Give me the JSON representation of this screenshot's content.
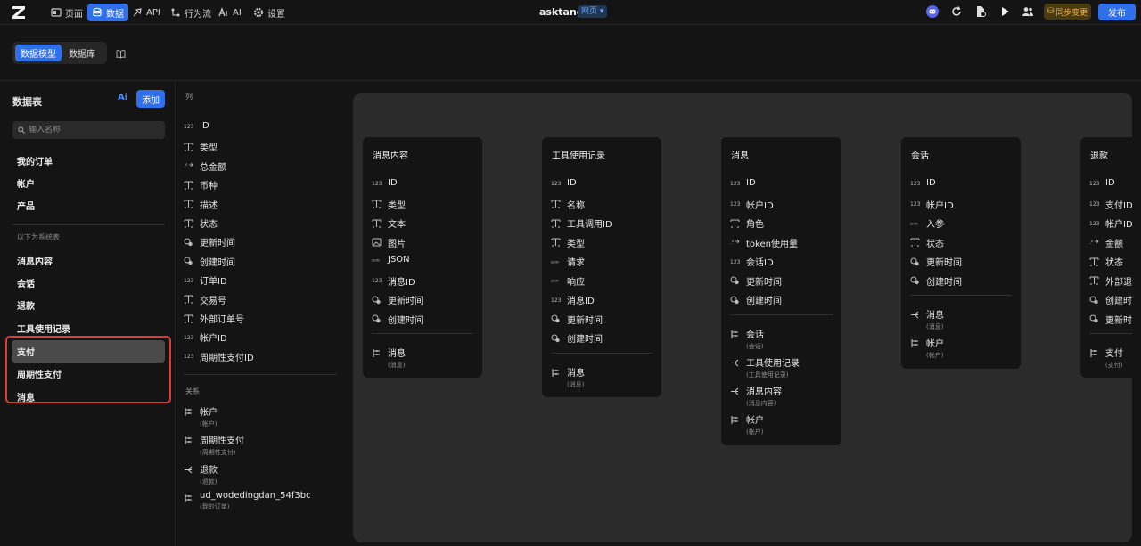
{
  "topbar": {
    "nav": [
      {
        "label": "页面",
        "icon": "pages-icon"
      },
      {
        "label": "数据",
        "icon": "database-icon"
      },
      {
        "label": "API",
        "icon": "api-icon"
      },
      {
        "label": "行为流",
        "icon": "flow-icon"
      },
      {
        "label": "AI",
        "icon": "ai-icon"
      },
      {
        "label": "设置",
        "icon": "gear-icon"
      }
    ],
    "app_title": "asktang",
    "page_badge": "网页",
    "sync_label": "同步变更",
    "publish_label": "发布",
    "accent": "#2f6fea"
  },
  "subbar": {
    "tabs": [
      "数据模型",
      "数据库"
    ]
  },
  "sidebar": {
    "title": "数据表",
    "ai_label": "Ai",
    "add_label": "添加",
    "search_placeholder": "输入名称",
    "user_tables": [
      "我的订单",
      "帐户",
      "产品"
    ],
    "system_section": "以下为系统表",
    "system_tables": [
      "消息内容",
      "会话",
      "退款",
      "工具使用记录",
      "支付",
      "周期性支付",
      "消息"
    ],
    "selected": "支付"
  },
  "columns_panel": {
    "columns_header": "列",
    "columns": [
      {
        "name": "ID",
        "icon": "number-icon"
      },
      {
        "name": "类型",
        "icon": "text-icon"
      },
      {
        "name": "总金额",
        "icon": "decimal-icon"
      },
      {
        "name": "币种",
        "icon": "text-icon"
      },
      {
        "name": "描述",
        "icon": "text-icon"
      },
      {
        "name": "状态",
        "icon": "text-icon"
      },
      {
        "name": "更新时间",
        "icon": "clock-icon"
      },
      {
        "name": "创建时间",
        "icon": "clock-icon"
      },
      {
        "name": "订单ID",
        "icon": "number-icon"
      },
      {
        "name": "交易号",
        "icon": "text-icon"
      },
      {
        "name": "外部订单号",
        "icon": "text-icon"
      },
      {
        "name": "帐户ID",
        "icon": "number-icon"
      },
      {
        "name": "周期性支付ID",
        "icon": "number-icon"
      }
    ],
    "relations_header": "关系",
    "relations": [
      {
        "name": "帐户",
        "sub": "(帐户)",
        "icon": "relation-one-icon"
      },
      {
        "name": "周期性支付",
        "sub": "(周期性支付)",
        "icon": "relation-one-icon"
      },
      {
        "name": "退款",
        "sub": "(退款)",
        "icon": "relation-many-icon"
      },
      {
        "name": "ud_wodedingdan_54f3bc",
        "sub": "(我的订单)",
        "icon": "relation-one-icon"
      }
    ]
  },
  "canvas": {
    "cards": [
      {
        "title": "消息内容",
        "fields": [
          {
            "name": "ID",
            "icon": "number-icon"
          },
          {
            "name": "类型",
            "icon": "text-icon"
          },
          {
            "name": "文本",
            "icon": "text-icon"
          },
          {
            "name": "图片",
            "icon": "image-icon"
          },
          {
            "name": "JSON",
            "icon": "json-icon"
          },
          {
            "name": "消息ID",
            "icon": "number-icon"
          },
          {
            "name": "更新时间",
            "icon": "clock-icon"
          },
          {
            "name": "创建时间",
            "icon": "clock-icon"
          }
        ],
        "relations": [
          {
            "name": "消息",
            "sub": "(消息)",
            "icon": "relation-one-icon"
          }
        ]
      },
      {
        "title": "工具使用记录",
        "fields": [
          {
            "name": "ID",
            "icon": "number-icon"
          },
          {
            "name": "名称",
            "icon": "text-icon"
          },
          {
            "name": "工具调用ID",
            "icon": "text-icon"
          },
          {
            "name": "类型",
            "icon": "text-icon"
          },
          {
            "name": "请求",
            "icon": "json-icon"
          },
          {
            "name": "响应",
            "icon": "json-icon"
          },
          {
            "name": "消息ID",
            "icon": "number-icon"
          },
          {
            "name": "更新时间",
            "icon": "clock-icon"
          },
          {
            "name": "创建时间",
            "icon": "clock-icon"
          }
        ],
        "relations": [
          {
            "name": "消息",
            "sub": "(消息)",
            "icon": "relation-one-icon"
          }
        ]
      },
      {
        "title": "消息",
        "fields": [
          {
            "name": "ID",
            "icon": "number-icon"
          },
          {
            "name": "帐户ID",
            "icon": "number-icon"
          },
          {
            "name": "角色",
            "icon": "text-icon"
          },
          {
            "name": "token使用量",
            "icon": "decimal-icon"
          },
          {
            "name": "会话ID",
            "icon": "number-icon"
          },
          {
            "name": "更新时间",
            "icon": "clock-icon"
          },
          {
            "name": "创建时间",
            "icon": "clock-icon"
          }
        ],
        "relations": [
          {
            "name": "会话",
            "sub": "(会话)",
            "icon": "relation-one-icon"
          },
          {
            "name": "工具使用记录",
            "sub": "(工具使用记录)",
            "icon": "relation-many-icon"
          },
          {
            "name": "消息内容",
            "sub": "(消息内容)",
            "icon": "relation-many-icon"
          },
          {
            "name": "帐户",
            "sub": "(帐户)",
            "icon": "relation-one-icon"
          }
        ]
      },
      {
        "title": "会话",
        "fields": [
          {
            "name": "ID",
            "icon": "number-icon"
          },
          {
            "name": "帐户ID",
            "icon": "number-icon"
          },
          {
            "name": "入参",
            "icon": "json-icon"
          },
          {
            "name": "状态",
            "icon": "text-icon"
          },
          {
            "name": "更新时间",
            "icon": "clock-icon"
          },
          {
            "name": "创建时间",
            "icon": "clock-icon"
          }
        ],
        "relations": [
          {
            "name": "消息",
            "sub": "(消息)",
            "icon": "relation-many-icon"
          },
          {
            "name": "帐户",
            "sub": "(帐户)",
            "icon": "relation-one-icon"
          }
        ]
      },
      {
        "title": "退款",
        "fields": [
          {
            "name": "ID",
            "icon": "number-icon"
          },
          {
            "name": "支付ID",
            "icon": "number-icon"
          },
          {
            "name": "帐户ID",
            "icon": "number-icon"
          },
          {
            "name": "金额",
            "icon": "decimal-icon"
          },
          {
            "name": "状态",
            "icon": "text-icon"
          },
          {
            "name": "外部退",
            "icon": "text-icon"
          },
          {
            "name": "创建时",
            "icon": "clock-icon"
          },
          {
            "name": "更新时",
            "icon": "clock-icon"
          }
        ],
        "relations": [
          {
            "name": "支付",
            "sub": "(支付)",
            "icon": "relation-one-icon"
          }
        ]
      }
    ]
  }
}
